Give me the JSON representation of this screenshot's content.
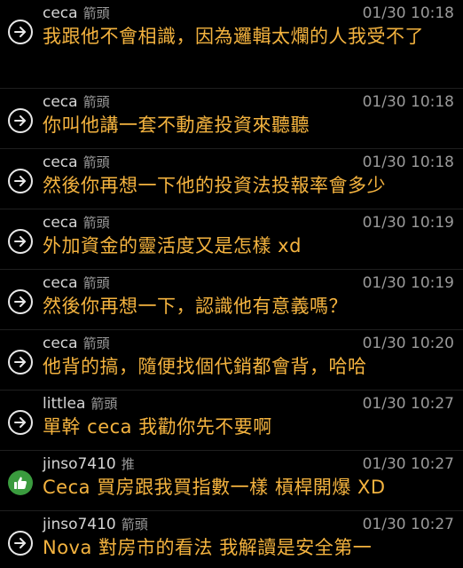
{
  "comments": [
    {
      "user": "ceca",
      "tag": "箭頭",
      "icon": "arrow-icon",
      "time": "01/30 10:18",
      "text": "我跟他不會相識，因為邏輯太爛的人我受不了"
    },
    {
      "user": "ceca",
      "tag": "箭頭",
      "icon": "arrow-icon",
      "time": "01/30 10:18",
      "text": "你叫他講一套不動產投資來聽聽"
    },
    {
      "user": "ceca",
      "tag": "箭頭",
      "icon": "arrow-icon",
      "time": "01/30 10:18",
      "text": "然後你再想一下他的投資法投報率會多少"
    },
    {
      "user": "ceca",
      "tag": "箭頭",
      "icon": "arrow-icon",
      "time": "01/30 10:19",
      "text": "外加資金的靈活度又是怎樣 xd"
    },
    {
      "user": "ceca",
      "tag": "箭頭",
      "icon": "arrow-icon",
      "time": "01/30 10:19",
      "text": "然後你再想一下，認識他有意義嗎？"
    },
    {
      "user": "ceca",
      "tag": "箭頭",
      "icon": "arrow-icon",
      "time": "01/30 10:20",
      "text": "他背的搞，隨便找個代銷都會背，哈哈"
    },
    {
      "user": "littlea",
      "tag": "箭頭",
      "icon": "arrow-icon",
      "time": "01/30 10:27",
      "text": "單幹 ceca 我勸你先不要啊"
    },
    {
      "user": "jinso7410",
      "tag": "推",
      "icon": "thumbs-up-icon",
      "time": "01/30 10:27",
      "text": "Ceca 買房跟我買指數一樣 槓桿開爆 XD"
    },
    {
      "user": "jinso7410",
      "tag": "箭頭",
      "icon": "arrow-icon",
      "time": "01/30 10:27",
      "text": "Nova 對房市的看法 我解讀是安全第一"
    }
  ],
  "colors": {
    "background": "#000000",
    "username": "#d5d5d5",
    "tag": "#9a9a9a",
    "time": "#9a9a9a",
    "message": "#f4b33f",
    "push_icon": "#3a9b3e"
  }
}
